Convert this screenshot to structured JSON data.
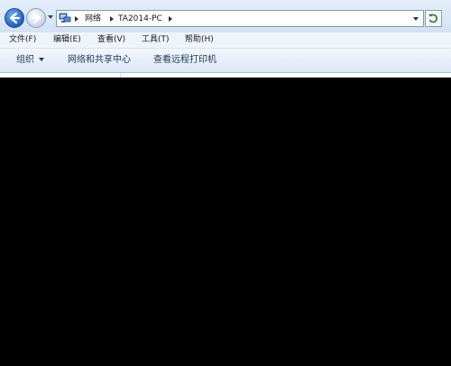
{
  "nav": {
    "back_icon": "back-arrow-icon",
    "forward_icon": "forward-arrow-icon",
    "address": {
      "icon": "network-icon",
      "crumbs": [
        "网络",
        "TA2014-PC"
      ]
    },
    "refresh_icon": "refresh-icon"
  },
  "menu": {
    "items": [
      "文件(F)",
      "编辑(E)",
      "查看(V)",
      "工具(T)",
      "帮助(H)"
    ]
  },
  "commands": {
    "organize": "组织",
    "network_center": "网络和共享中心",
    "view_printers": "查看远程打印机"
  },
  "colors": {
    "accent": "#1f5fbf",
    "background": "#000000"
  }
}
